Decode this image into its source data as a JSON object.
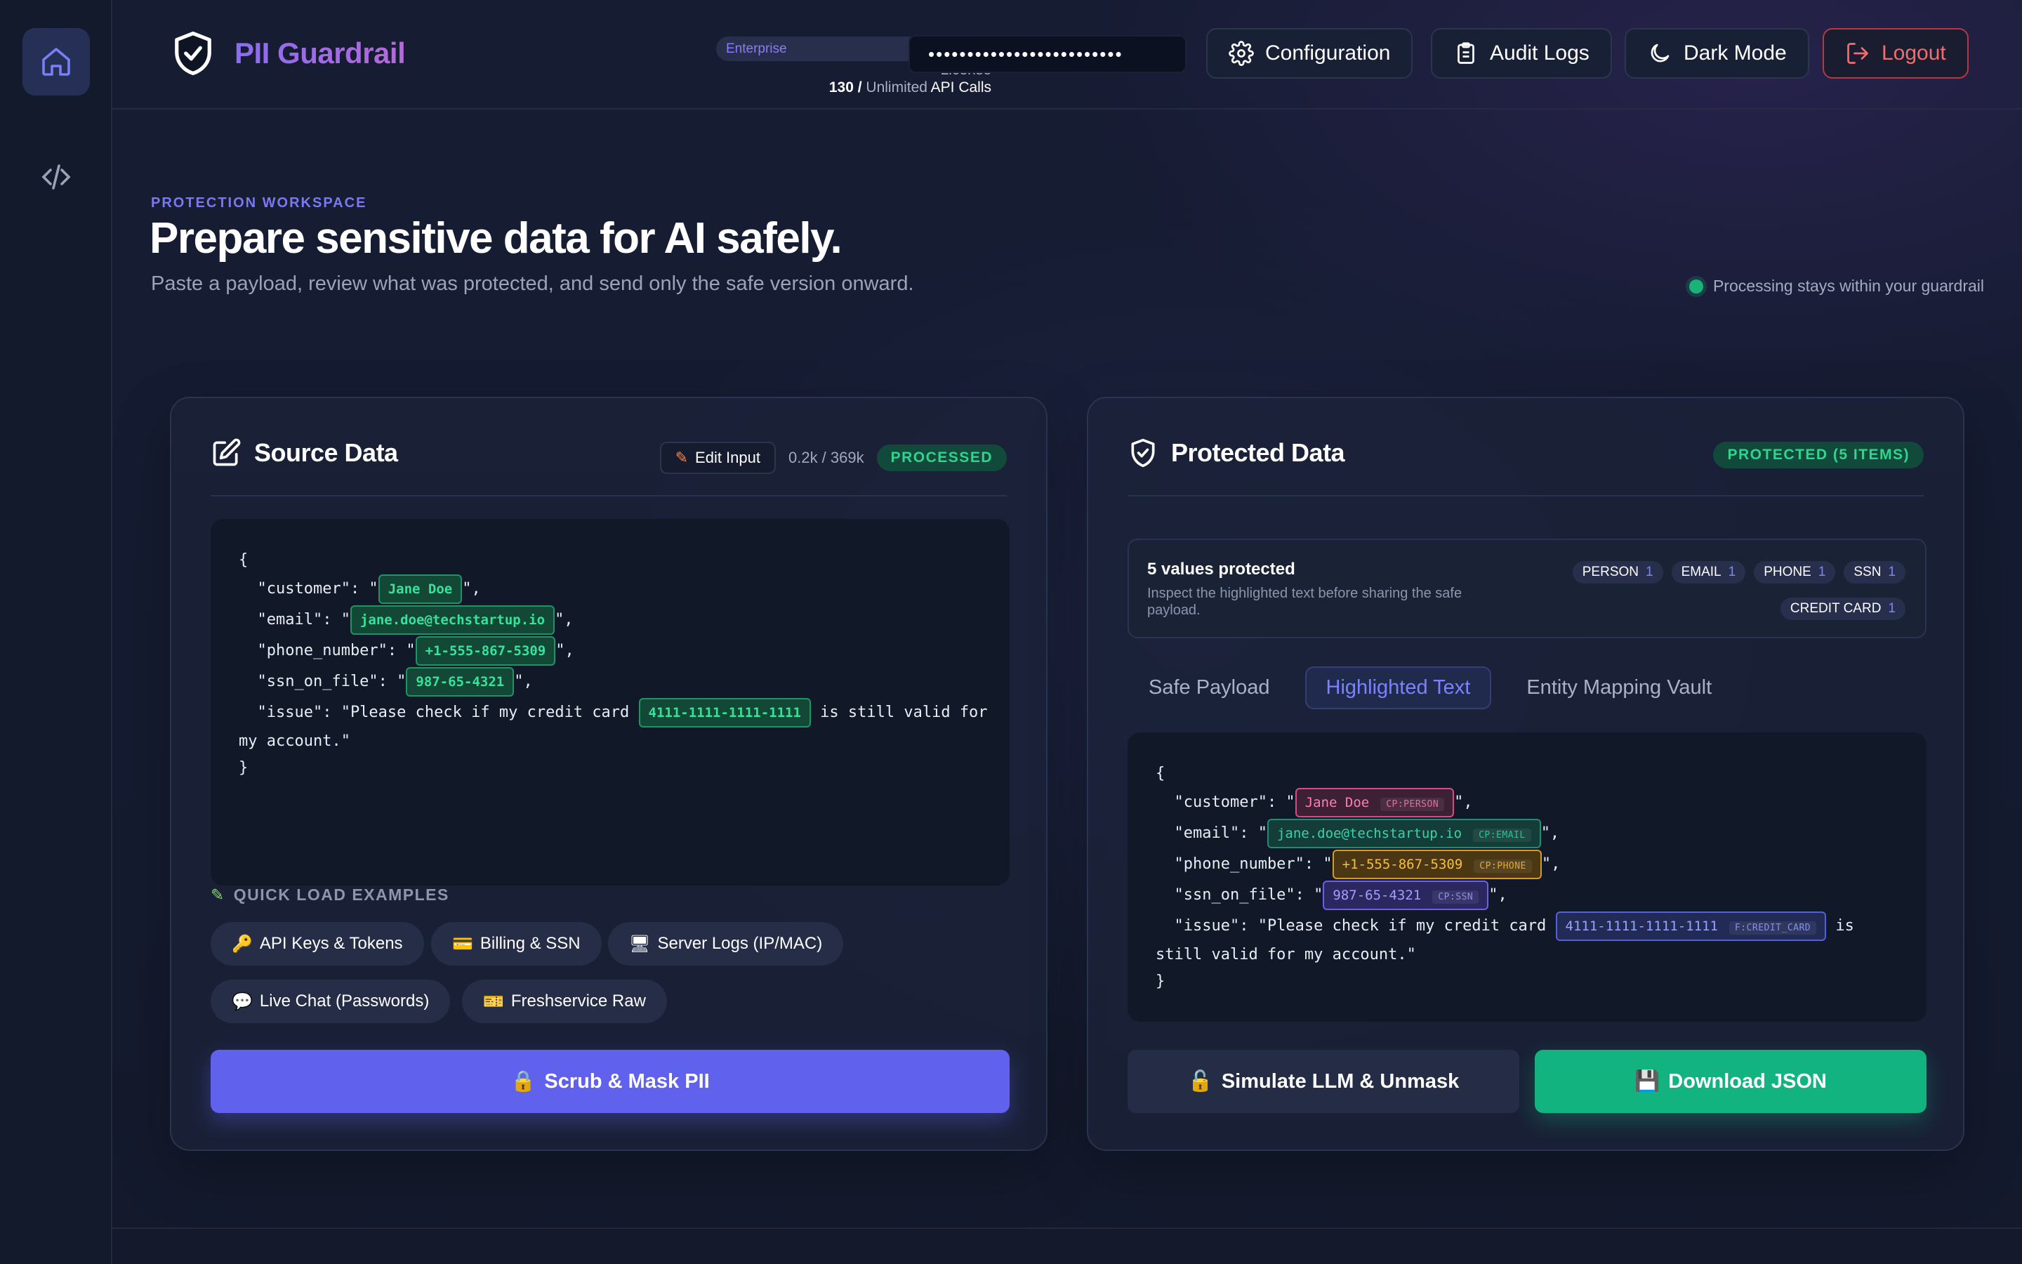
{
  "header": {
    "brand": "PII Guardrail",
    "license_tier": "Enterprise",
    "license_word": "License",
    "usage_count": "130 /",
    "usage_limit": "Unlimited",
    "usage_suffix": "API Calls",
    "api_key_masked": "•••••••••••••••••••••••••",
    "buttons": {
      "configuration": "Configuration",
      "audit_logs": "Audit Logs",
      "dark_mode": "Dark Mode",
      "logout": "Logout"
    }
  },
  "hero": {
    "eyebrow": "PROTECTION WORKSPACE",
    "title": "Prepare sensitive data for AI safely.",
    "subtitle": "Paste a payload, review what was protected, and send only the safe version onward.",
    "status": "Processing stays within your guardrail"
  },
  "source": {
    "title": "Source Data",
    "edit_label": "Edit Input",
    "counter": "0.2k / 369k",
    "status": "PROCESSED",
    "code": {
      "open": "{",
      "customer_key": "  \"customer\": \"",
      "customer_val": "Jane Doe",
      "email_key": "  \"email\": \"",
      "email_val": "jane.doe@techstartup.io",
      "phone_key": "  \"phone_number\": \"",
      "phone_val": "+1-555-867-5309",
      "ssn_key": "  \"ssn_on_file\": \"",
      "ssn_val": "987-65-4321",
      "issue_pre": "  \"issue\": \"Please check if my credit card ",
      "card_val": "4111-1111-1111-1111",
      "issue_post": " is still valid for",
      "issue_wrap": "my account.\"",
      "close": "}",
      "line_end": "\",",
      "line_end_sp": " \","
    },
    "quick_label": "QUICK LOAD EXAMPLES",
    "examples": [
      {
        "icon": "🔑",
        "label": "API Keys & Tokens"
      },
      {
        "icon": "💳",
        "label": "Billing & SSN"
      },
      {
        "icon": "🖥",
        "label": "Server Logs (IP/MAC)"
      },
      {
        "icon": "💬",
        "label": "Live Chat (Passwords)"
      },
      {
        "icon": "🎫",
        "label": "Freshservice Raw"
      }
    ],
    "scrub_button": "Scrub & Mask PII",
    "scrub_icon": "🔒"
  },
  "protected": {
    "title": "Protected Data",
    "status": "PROTECTED (5 ITEMS)",
    "summary_title": "5 values protected",
    "summary_desc": "Inspect the highlighted text before sharing the safe payload.",
    "entities": [
      {
        "name": "PERSON",
        "count": "1"
      },
      {
        "name": "EMAIL",
        "count": "1"
      },
      {
        "name": "PHONE",
        "count": "1"
      },
      {
        "name": "SSN",
        "count": "1"
      },
      {
        "name": "CREDIT CARD",
        "count": "1"
      }
    ],
    "tabs": [
      "Safe Payload",
      "Highlighted Text",
      "Entity Mapping Vault"
    ],
    "active_tab": "Highlighted Text",
    "code": {
      "customer_tag": "CP:PERSON",
      "email_tag": "CP:EMAIL",
      "phone_tag": "CP:PHONE",
      "ssn_tag": "CP:SSN",
      "card_tag": "F:CREDIT_CARD",
      "issue_post": " is",
      "issue_wrap": "still valid for my account.\""
    },
    "simulate_button": "Simulate LLM & Unmask",
    "simulate_icon": "🔓",
    "download_button": "Download JSON",
    "download_icon": "💾"
  },
  "colors": {
    "accent": "#6062ee",
    "success": "#13b37f",
    "danger": "#f26d6d"
  }
}
